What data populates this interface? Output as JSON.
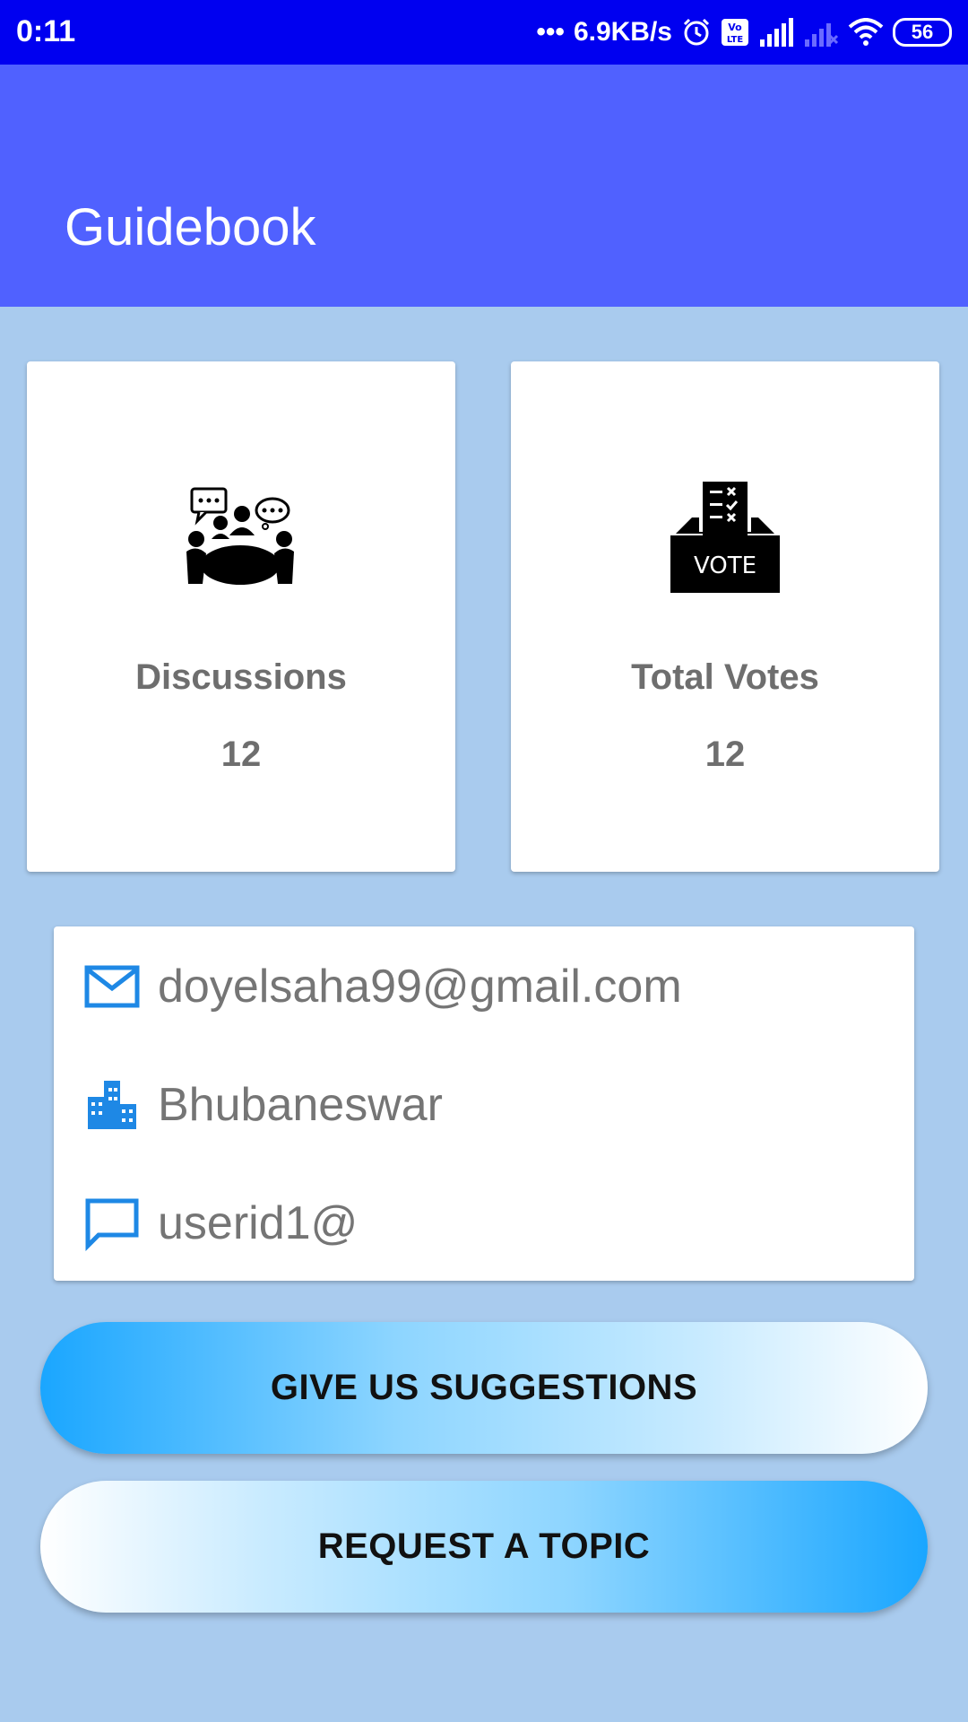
{
  "status_bar": {
    "time": "0:11",
    "network_speed": "6.9KB/s",
    "battery": "56",
    "icons": [
      "dots-icon",
      "alarm-icon",
      "volte-icon",
      "signal-icon",
      "signal-empty-icon",
      "wifi-icon",
      "battery-icon"
    ]
  },
  "app_bar": {
    "title": "Guidebook",
    "color": "#5061ff"
  },
  "stats": [
    {
      "label": "Discussions",
      "value": "12",
      "icon": "discussion-icon"
    },
    {
      "label": "Total Votes",
      "value": "12",
      "icon": "vote-box-icon",
      "icon_text": "VOTE"
    }
  ],
  "profile": {
    "email": "doyelsaha99@gmail.com",
    "city": "Bhubaneswar",
    "user_id": "userid1@"
  },
  "buttons": {
    "suggestions": "GIVE US SUGGESTIONS",
    "request_topic": "REQUEST A TOPIC"
  },
  "colors": {
    "background": "#a9cbee",
    "status_bar": "#0000f0",
    "accent_icon": "#1e88e5",
    "button_gradient": "#1aa6ff"
  }
}
